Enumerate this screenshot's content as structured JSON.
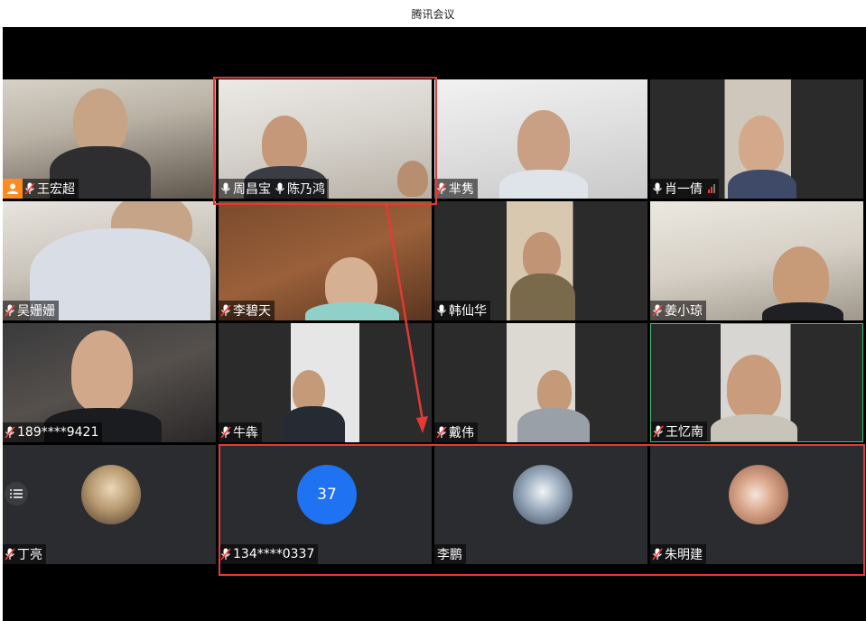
{
  "window": {
    "title": "腾讯会议"
  },
  "participants": [
    {
      "name": "王宏超",
      "muted": true,
      "host": true
    },
    {
      "name": "周昌宝",
      "muted": false,
      "second_name": "陈乃鸿"
    },
    {
      "name": "芈隽",
      "muted": true
    },
    {
      "name": "肖一倩",
      "muted": false,
      "signal": "weak"
    },
    {
      "name": "吴姗姗",
      "muted": true
    },
    {
      "name": "李碧天",
      "muted": true
    },
    {
      "name": "韩仙华",
      "muted": false
    },
    {
      "name": "姜小琼",
      "muted": true
    },
    {
      "name": "189****9421",
      "muted": true
    },
    {
      "name": "牛犇",
      "muted": true
    },
    {
      "name": "戴伟",
      "muted": true
    },
    {
      "name": "王忆南",
      "muted": true,
      "speaking": true
    },
    {
      "name": "丁亮",
      "muted": true,
      "avatar": "photo-avatar"
    },
    {
      "name": "134****0337",
      "muted": true,
      "avatar_text": "37"
    },
    {
      "name": "李鹏",
      "muted": false,
      "avatar": "photo-avatar"
    },
    {
      "name": "朱明建",
      "muted": true,
      "avatar": "photo-avatar"
    }
  ],
  "icons": {
    "list": "list-icon",
    "mic": "mic-icon",
    "mic_muted": "mic-muted-icon",
    "host": "host-icon"
  },
  "colors": {
    "highlight": "#e53935",
    "host_badge": "#ff8a1f",
    "number_avatar": "#1f72f2",
    "speaking_border": "#3bc77a"
  }
}
